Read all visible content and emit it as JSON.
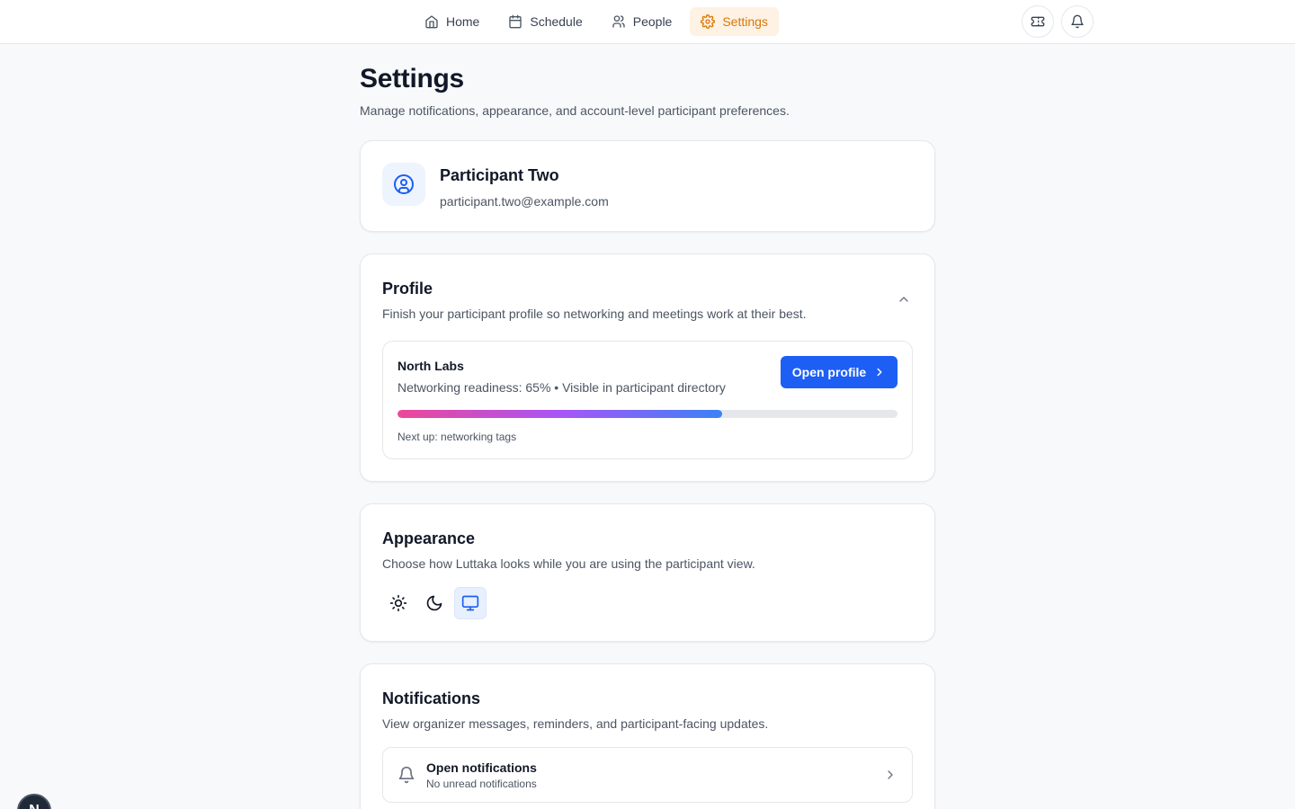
{
  "nav": {
    "items": [
      {
        "label": "Home",
        "icon": "home-icon"
      },
      {
        "label": "Schedule",
        "icon": "calendar-icon"
      },
      {
        "label": "People",
        "icon": "users-icon"
      },
      {
        "label": "Settings",
        "icon": "gear-icon",
        "active": true
      }
    ],
    "actions": [
      {
        "icon": "ticket-icon"
      },
      {
        "icon": "bell-icon"
      }
    ]
  },
  "page": {
    "title": "Settings",
    "subtitle": "Manage notifications, appearance, and account-level participant preferences."
  },
  "user": {
    "name": "Participant Two",
    "email": "participant.two@example.com"
  },
  "profile": {
    "title": "Profile",
    "description": "Finish your participant profile so networking and meetings work at their best.",
    "org_name": "North Labs",
    "meta": "Networking readiness: 65% • Visible in participant directory",
    "readiness_percent": 65,
    "open_label": "Open profile",
    "next_up": "Next up: networking tags"
  },
  "appearance": {
    "title": "Appearance",
    "description": "Choose how Luttaka looks while you are using the participant view.",
    "options": [
      "sun-icon",
      "moon-icon",
      "monitor-icon"
    ],
    "selected": "monitor-icon"
  },
  "notifications": {
    "title": "Notifications",
    "description": "View organizer messages, reminders, and participant-facing updates.",
    "row_title": "Open notifications",
    "row_sub": "No unread notifications"
  },
  "fab_letter": "N",
  "colors": {
    "accent": "#1d5ef5",
    "active_nav_bg": "#fdf2e3",
    "active_nav_text": "#d97706"
  }
}
